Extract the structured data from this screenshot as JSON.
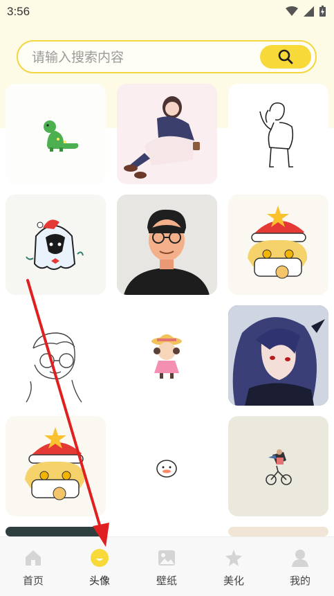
{
  "status_bar": {
    "time": "3:56"
  },
  "search": {
    "placeholder": "请输入搜索内容",
    "icon": "search-icon"
  },
  "gallery": {
    "items": [
      {
        "subject": "green dinosaur sticker"
      },
      {
        "subject": "girl in white skirt sitting"
      },
      {
        "subject": "line art boy standing"
      },
      {
        "subject": "white ghost with santa hat"
      },
      {
        "subject": "man with glasses"
      },
      {
        "subject": "blonde chibi with christmas hat"
      },
      {
        "subject": "sketch boy with glasses"
      },
      {
        "subject": "small girl with straw hat"
      },
      {
        "subject": "anime girl with blue hair"
      },
      {
        "subject": "blonde chibi with christmas hat"
      },
      {
        "subject": "small white bun"
      },
      {
        "subject": "people on bicycle"
      }
    ]
  },
  "bottom_nav": {
    "items": [
      {
        "label": "首页",
        "icon": "home-icon",
        "active": false
      },
      {
        "label": "头像",
        "icon": "avatar-icon",
        "active": true
      },
      {
        "label": "壁纸",
        "icon": "wallpaper-icon",
        "active": false
      },
      {
        "label": "美化",
        "icon": "beautify-icon",
        "active": false
      },
      {
        "label": "我的",
        "icon": "profile-icon",
        "active": false
      }
    ]
  },
  "colors": {
    "accent": "#f7d93a",
    "arrow": "#e02020"
  }
}
